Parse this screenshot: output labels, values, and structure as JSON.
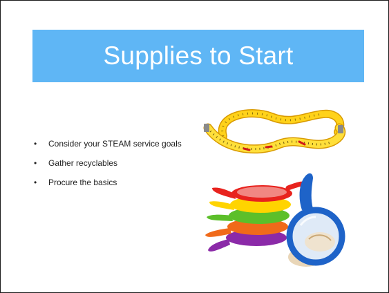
{
  "slide": {
    "title": "Supplies to Start",
    "bullets": [
      "Consider your STEAM service goals",
      "Gather recyclables",
      "Procure the basics"
    ],
    "images": [
      {
        "icon": "measuring-tape-icon"
      },
      {
        "icon": "magnifying-glass-icon"
      }
    ]
  },
  "colors": {
    "title_bar": "#5fb6f5",
    "title_text": "#ffffff",
    "body_text": "#222222"
  }
}
